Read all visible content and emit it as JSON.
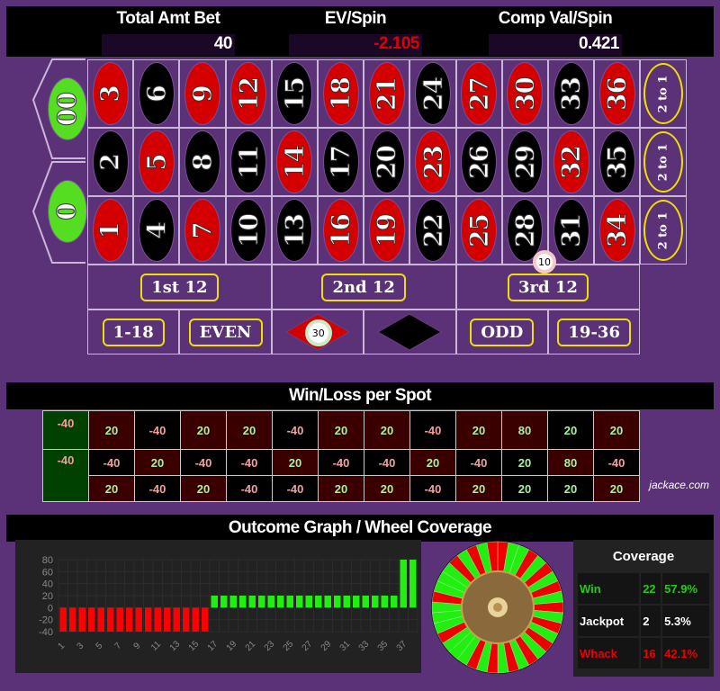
{
  "stats": [
    {
      "label": "Total Amt Bet",
      "value": "40",
      "negative": false
    },
    {
      "label": "EV/Spin",
      "value": "-2.105",
      "negative": true
    },
    {
      "label": "Comp Val/Spin",
      "value": "0.421",
      "negative": false
    }
  ],
  "board": {
    "zeros": [
      {
        "label": "00"
      },
      {
        "label": "0"
      }
    ],
    "rows": [
      [
        {
          "n": "3",
          "c": "red"
        },
        {
          "n": "6",
          "c": "black"
        },
        {
          "n": "9",
          "c": "red"
        },
        {
          "n": "12",
          "c": "red"
        },
        {
          "n": "15",
          "c": "black"
        },
        {
          "n": "18",
          "c": "red"
        },
        {
          "n": "21",
          "c": "red"
        },
        {
          "n": "24",
          "c": "black"
        },
        {
          "n": "27",
          "c": "red"
        },
        {
          "n": "30",
          "c": "red"
        },
        {
          "n": "33",
          "c": "black"
        },
        {
          "n": "36",
          "c": "red"
        }
      ],
      [
        {
          "n": "2",
          "c": "black"
        },
        {
          "n": "5",
          "c": "red"
        },
        {
          "n": "8",
          "c": "black"
        },
        {
          "n": "11",
          "c": "black"
        },
        {
          "n": "14",
          "c": "red"
        },
        {
          "n": "17",
          "c": "black"
        },
        {
          "n": "20",
          "c": "black"
        },
        {
          "n": "23",
          "c": "red"
        },
        {
          "n": "26",
          "c": "black"
        },
        {
          "n": "29",
          "c": "black"
        },
        {
          "n": "32",
          "c": "red"
        },
        {
          "n": "35",
          "c": "black"
        }
      ],
      [
        {
          "n": "1",
          "c": "red"
        },
        {
          "n": "4",
          "c": "black"
        },
        {
          "n": "7",
          "c": "red"
        },
        {
          "n": "10",
          "c": "black"
        },
        {
          "n": "13",
          "c": "black"
        },
        {
          "n": "16",
          "c": "red"
        },
        {
          "n": "19",
          "c": "red"
        },
        {
          "n": "22",
          "c": "black"
        },
        {
          "n": "25",
          "c": "red"
        },
        {
          "n": "28",
          "c": "black"
        },
        {
          "n": "31",
          "c": "black"
        },
        {
          "n": "34",
          "c": "red"
        }
      ]
    ],
    "column_bets": [
      "2 to 1",
      "2 to 1",
      "2 to 1"
    ],
    "dozens": [
      "1st 12",
      "2nd 12",
      "3rd 12"
    ],
    "outside": [
      "1-18",
      "EVEN",
      "ODD",
      "19-36"
    ],
    "chips": [
      {
        "spot": "street-28-31",
        "value": "10"
      },
      {
        "spot": "red",
        "value": "30"
      }
    ]
  },
  "winloss": {
    "title": "Win/Loss per Spot",
    "zeros": [
      "-40",
      "-40"
    ],
    "rows": [
      [
        "20",
        "-40",
        "20",
        "20",
        "-40",
        "20",
        "20",
        "-40",
        "20",
        "80",
        "20",
        "20"
      ],
      [
        "-40",
        "20",
        "-40",
        "-40",
        "20",
        "-40",
        "-40",
        "20",
        "-40",
        "20",
        "80",
        "-40"
      ],
      [
        "20",
        "-40",
        "20",
        "-40",
        "-40",
        "20",
        "20",
        "-40",
        "20",
        "20",
        "20",
        "20"
      ]
    ],
    "credit": "jackace.com"
  },
  "outcome": {
    "title": "Outcome Graph / Wheel Coverage"
  },
  "chart_data": {
    "type": "bar",
    "title": "Outcome Graph",
    "xlabel": "",
    "ylabel": "",
    "ylim": [
      -40,
      80
    ],
    "yticks": [
      80,
      60,
      40,
      20,
      0,
      -20,
      -40
    ],
    "xticks": [
      "1",
      "3",
      "5",
      "7",
      "9",
      "11",
      "13",
      "15",
      "17",
      "19",
      "21",
      "23",
      "25",
      "27",
      "29",
      "31",
      "33",
      "35",
      "37"
    ],
    "x": [
      1,
      2,
      3,
      4,
      5,
      6,
      7,
      8,
      9,
      10,
      11,
      12,
      13,
      14,
      15,
      16,
      17,
      18,
      19,
      20,
      21,
      22,
      23,
      24,
      25,
      26,
      27,
      28,
      29,
      30,
      31,
      32,
      33,
      34,
      35,
      36,
      37,
      38
    ],
    "values": [
      -40,
      -40,
      -40,
      -40,
      -40,
      -40,
      -40,
      -40,
      -40,
      -40,
      -40,
      -40,
      -40,
      -40,
      -40,
      -40,
      20,
      20,
      20,
      20,
      20,
      20,
      20,
      20,
      20,
      20,
      20,
      20,
      20,
      20,
      20,
      20,
      20,
      20,
      20,
      20,
      80,
      80
    ],
    "colors": {
      "positive": "#22ee11",
      "negative": "#ff0000"
    },
    "grid": true
  },
  "coverage": {
    "title": "Coverage",
    "rows": [
      {
        "label": "Win",
        "count": "22",
        "pct": "57.9%",
        "color": "#22cc11"
      },
      {
        "label": "Jackpot",
        "count": "2",
        "pct": "5.3%",
        "color": "#ffffff"
      },
      {
        "label": "Whack",
        "count": "16",
        "pct": "42.1%",
        "color": "#ee0000"
      }
    ]
  }
}
